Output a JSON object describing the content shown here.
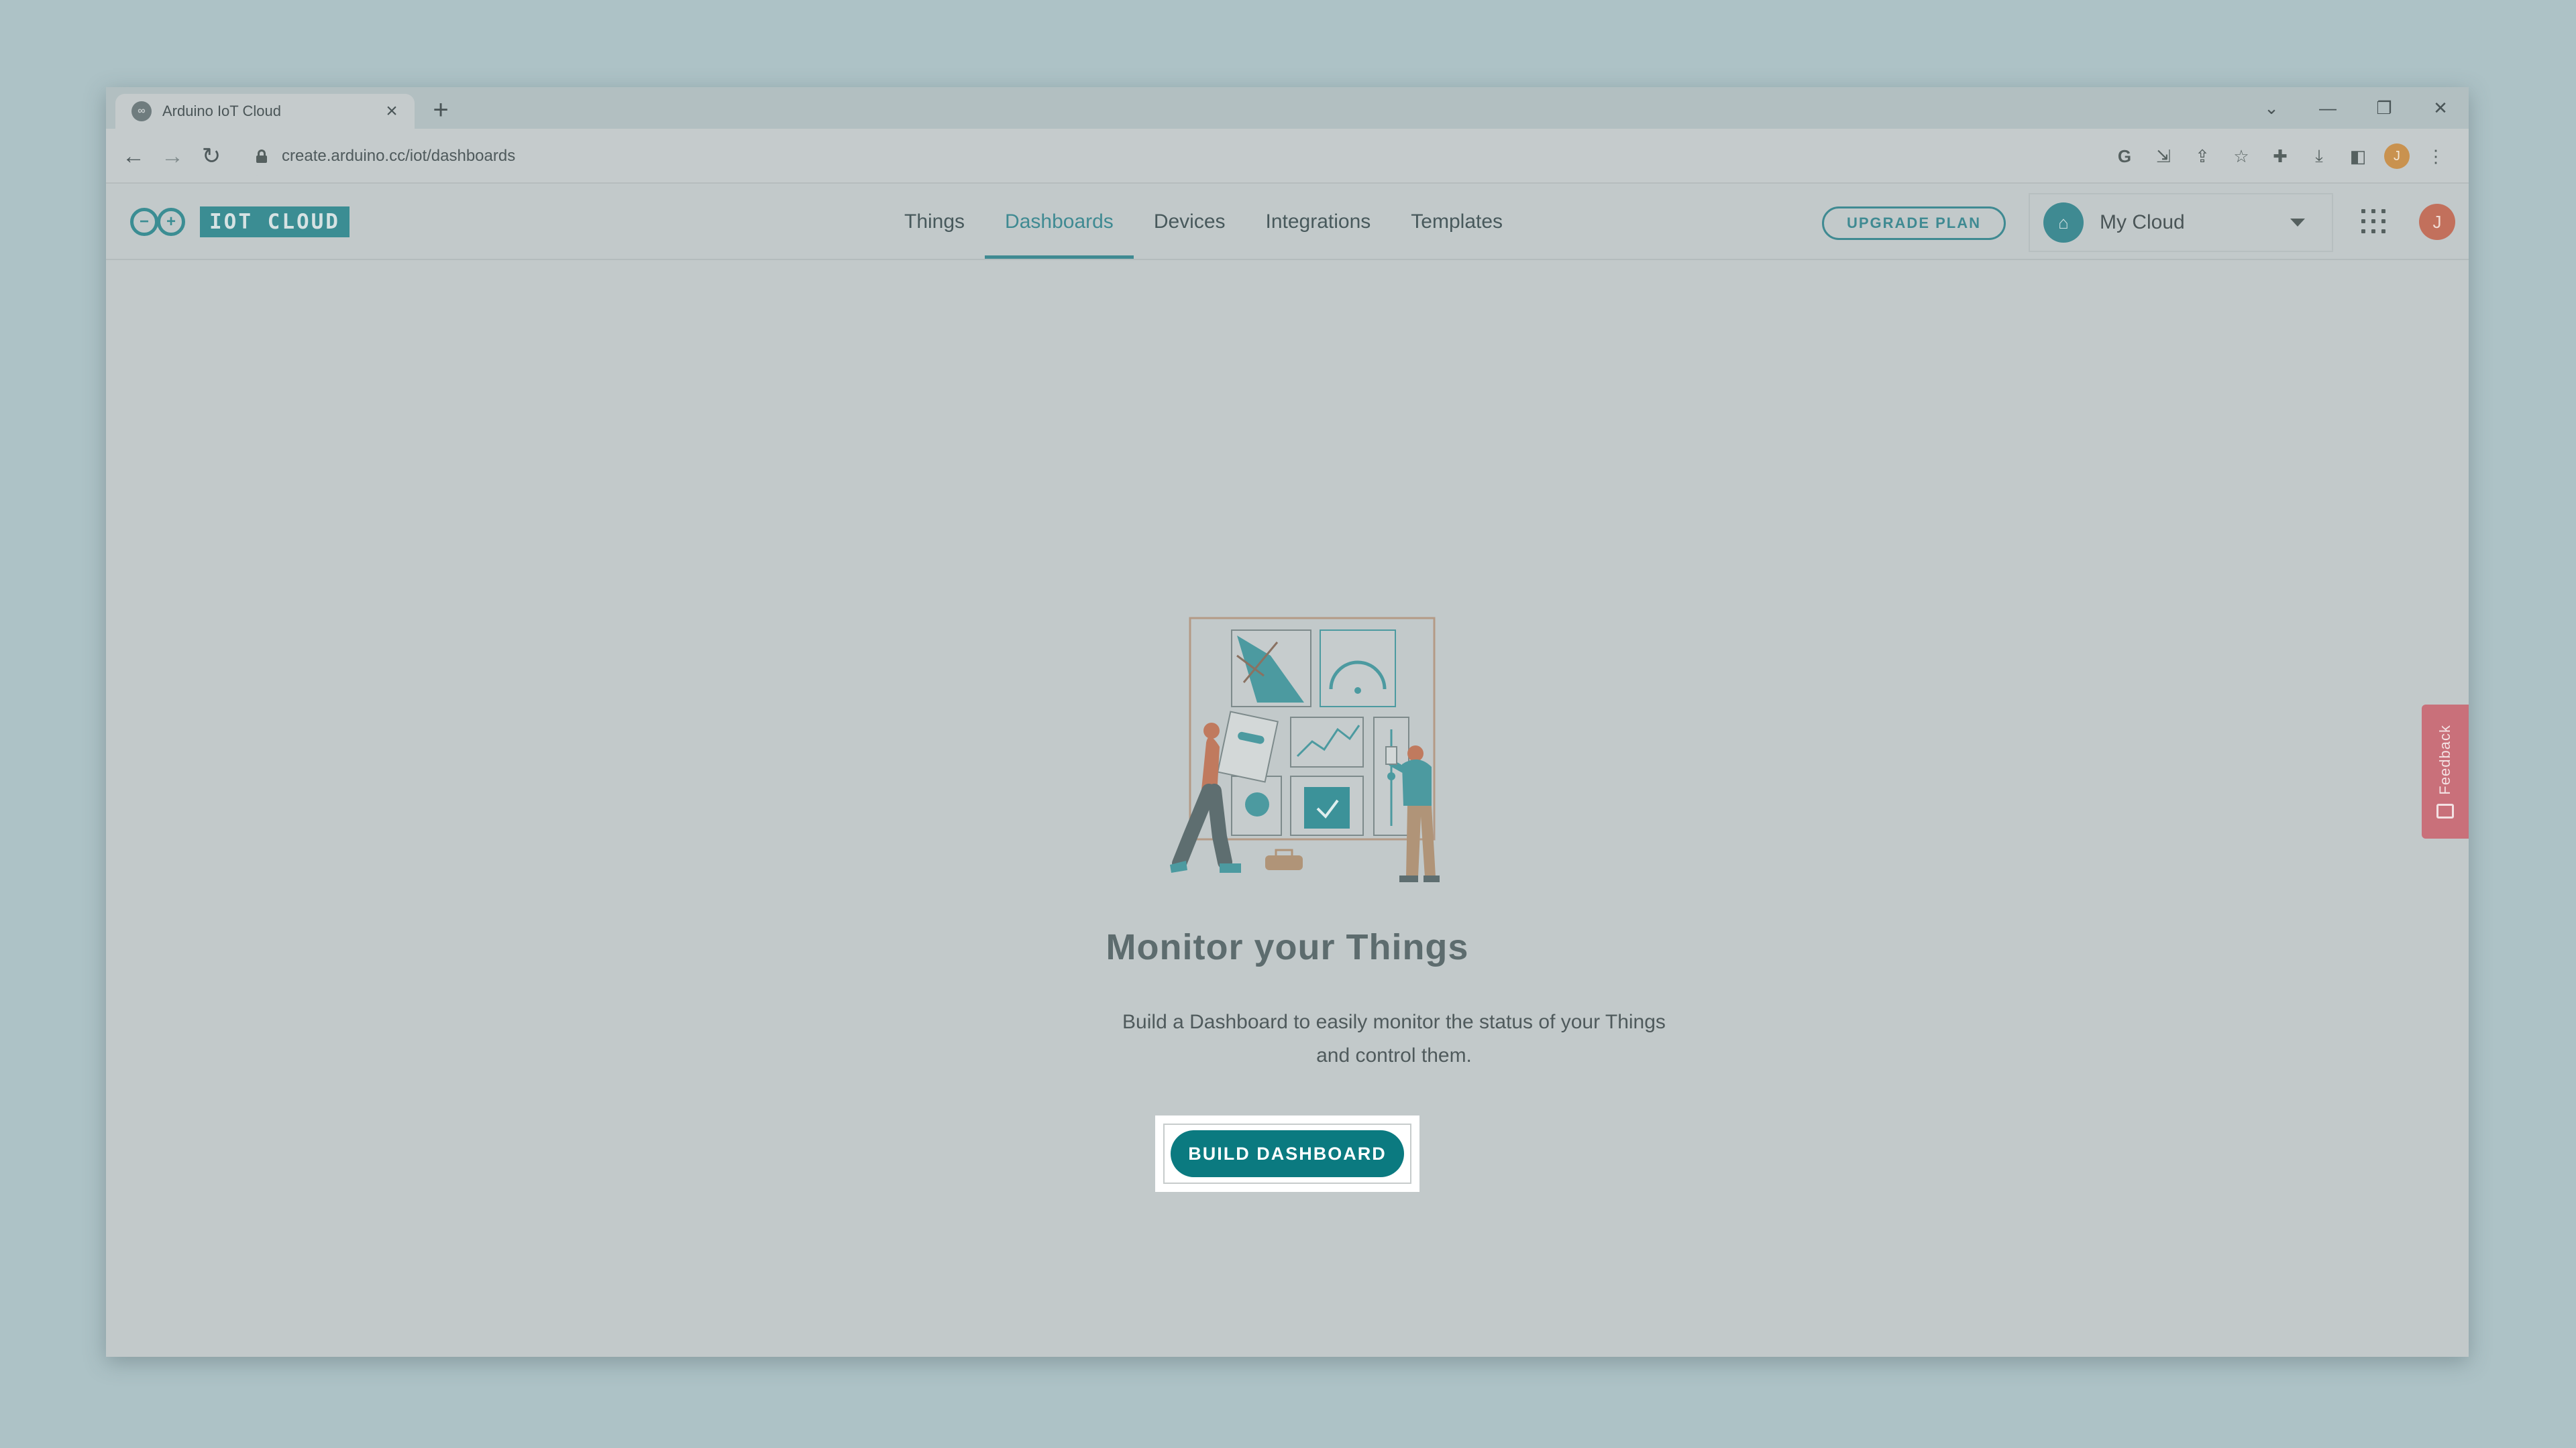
{
  "browser": {
    "tab": {
      "title": "Arduino IoT Cloud",
      "favicon_icon": "arduino-icon",
      "close_glyph": "×"
    },
    "new_tab_glyph": "+",
    "window_controls": {
      "tab_search_glyph": "⌄",
      "minimize_glyph": "—",
      "restore_glyph": "❐",
      "close_glyph": "✕"
    },
    "nav": {
      "back_glyph": "←",
      "forward_glyph": "→",
      "reload_glyph": "↻"
    },
    "url": "create.arduino.cc/iot/dashboards",
    "extensions": [
      {
        "icon": "google-icon",
        "glyph": "G"
      },
      {
        "icon": "install-icon",
        "glyph": "⇲"
      },
      {
        "icon": "share-icon",
        "glyph": "⇪"
      },
      {
        "icon": "bookmark-star-icon",
        "glyph": "☆"
      },
      {
        "icon": "extensions-puzzle-icon",
        "glyph": "✚"
      },
      {
        "icon": "download-icon",
        "glyph": "⤓"
      },
      {
        "icon": "side-panel-icon",
        "glyph": "◧"
      }
    ],
    "profile_initial": "J",
    "menu_glyph": "⋮"
  },
  "app": {
    "logo": {
      "minus_glyph": "−",
      "plus_glyph": "+",
      "text": "IOT CLOUD"
    },
    "nav": [
      {
        "label": "Things",
        "active": false
      },
      {
        "label": "Dashboards",
        "active": true
      },
      {
        "label": "Devices",
        "active": false
      },
      {
        "label": "Integrations",
        "active": false
      },
      {
        "label": "Templates",
        "active": false
      }
    ],
    "upgrade_label": "UPGRADE PLAN",
    "space": {
      "icon": "home-icon",
      "icon_glyph": "⌂",
      "name": "My Cloud"
    },
    "user_initial": "J"
  },
  "empty_state": {
    "title": "Monitor your Things",
    "description": "Build a Dashboard to easily monitor the status of your Things and control them.",
    "button_label": "BUILD DASHBOARD"
  },
  "feedback": {
    "label": "Feedback",
    "icon": "feedback-icon"
  },
  "colors": {
    "accent": "#3f8a92",
    "primary_button": "#0b7a80",
    "feedback": "#c9707a",
    "avatar": "#c2705c"
  }
}
